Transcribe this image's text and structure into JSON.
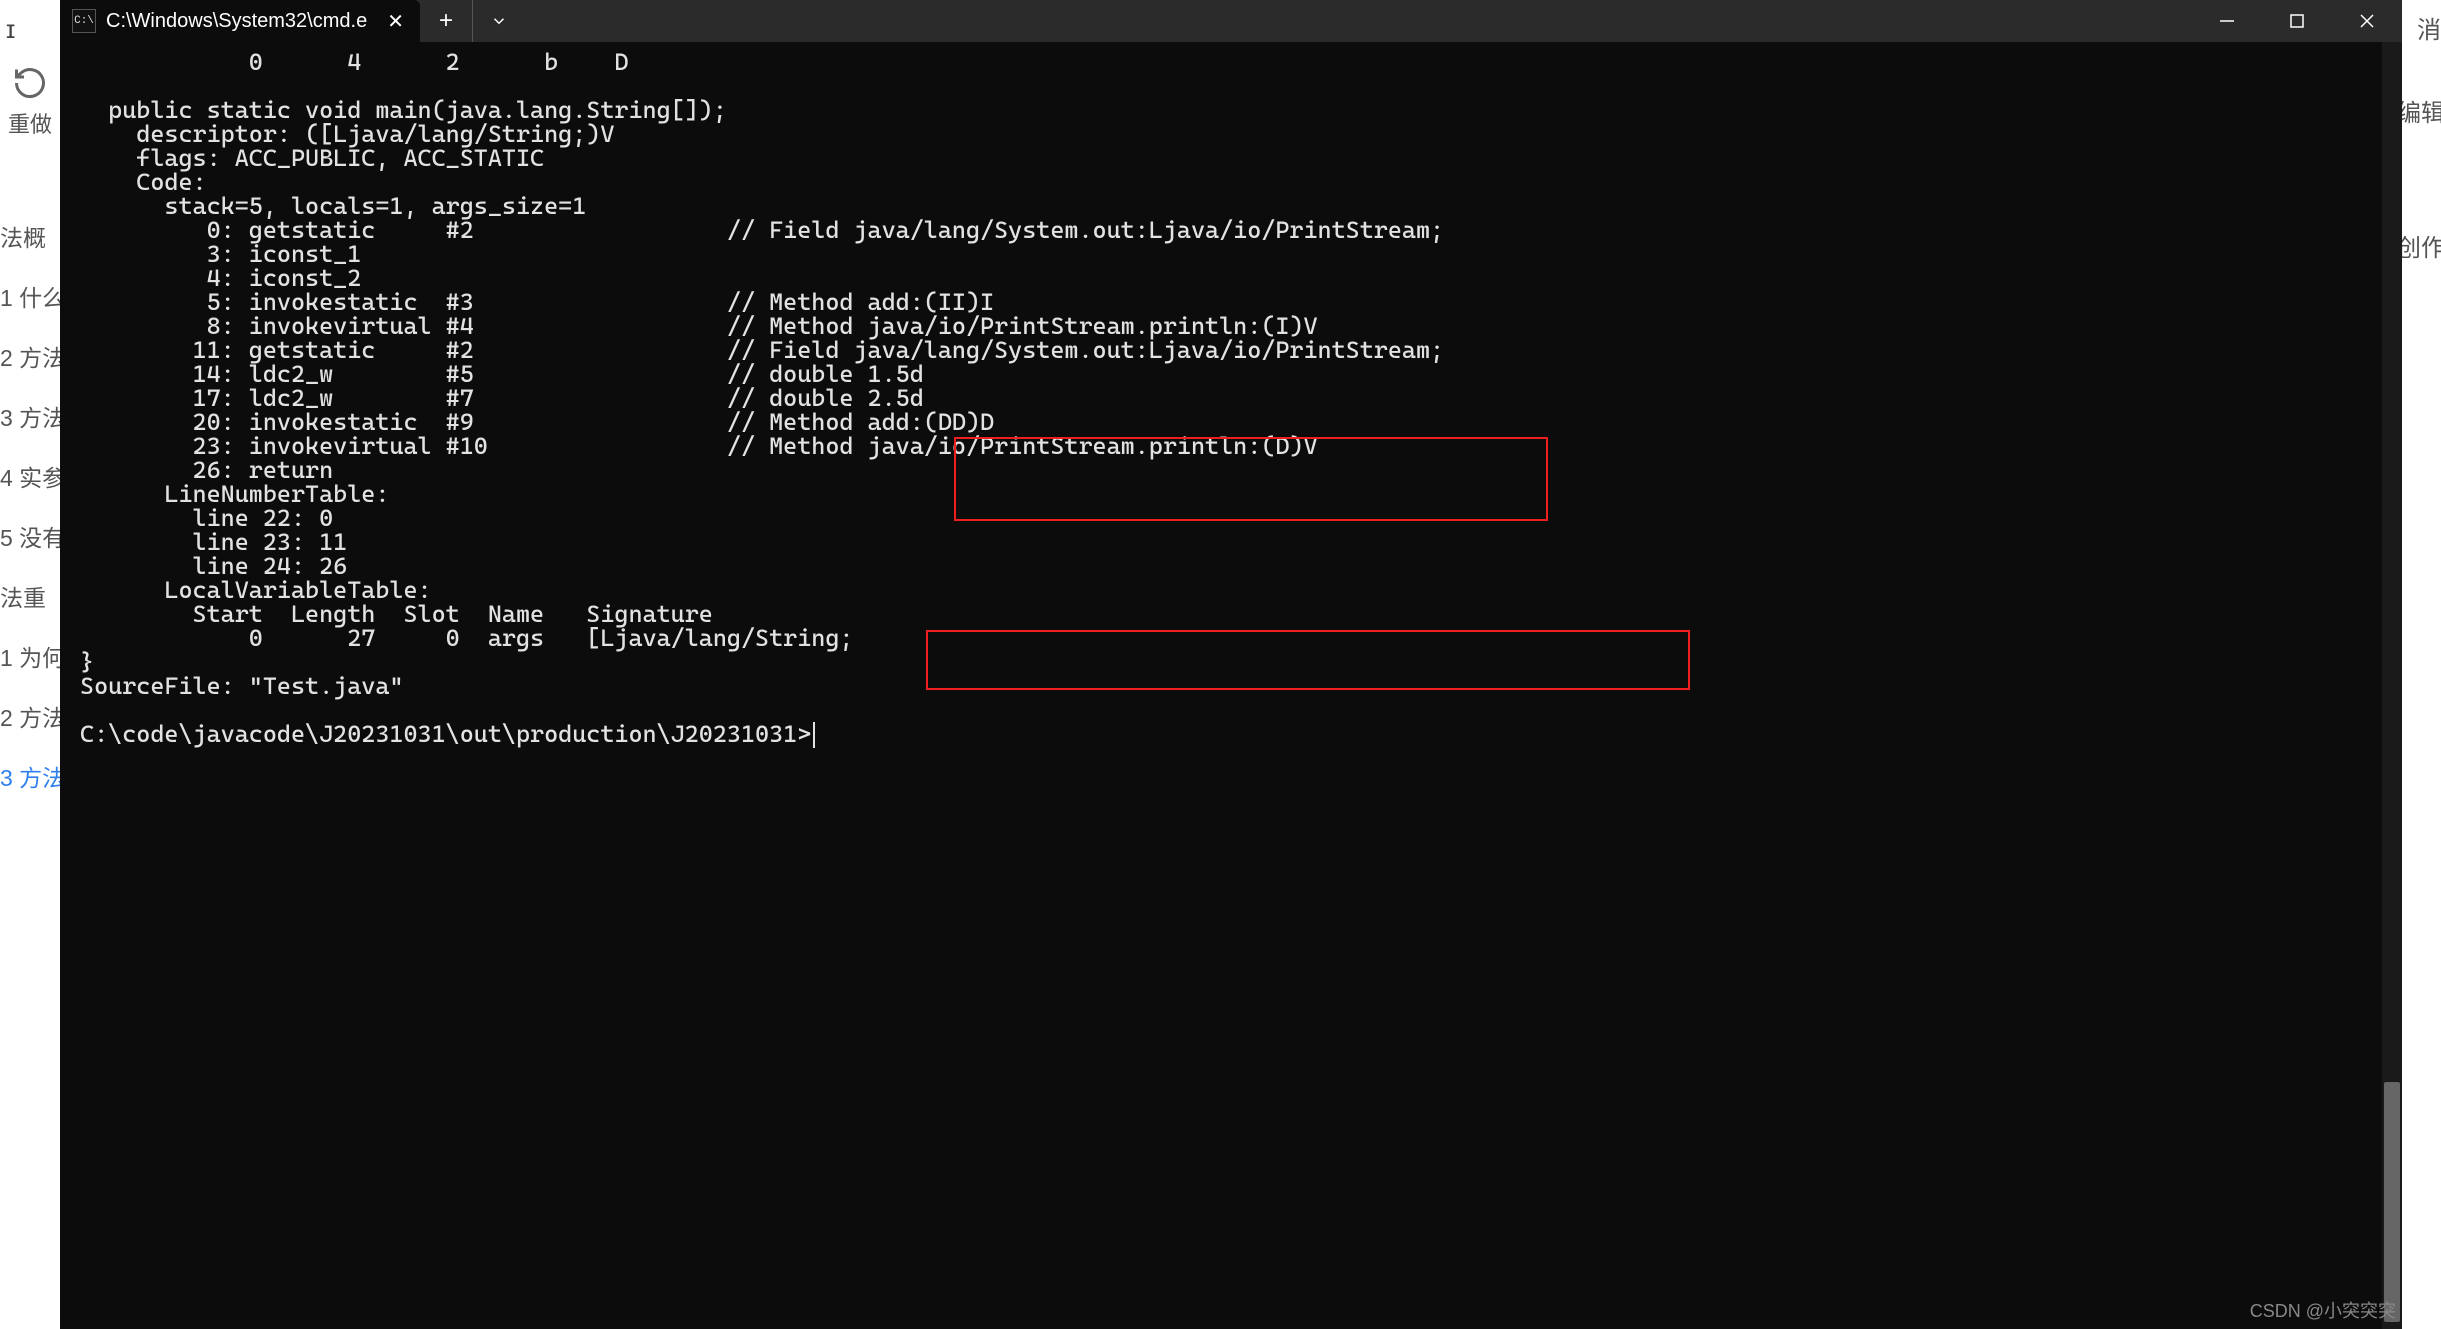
{
  "left_strip": {
    "refresh_label": "重做",
    "top_fragment": "ɪ",
    "items": [
      "法概",
      "1 什么",
      "2 方法",
      "3 方法",
      "4 实参",
      "5 没有",
      "法重",
      "1 为何",
      "2 方法",
      "3 方法"
    ],
    "active_index": 9
  },
  "right_strip": {
    "items_top": [
      "消",
      "编辑"
    ],
    "items_mid": [
      "创作"
    ]
  },
  "window": {
    "tab_title": "C:\\Windows\\System32\\cmd.e",
    "new_tab_tooltip": "+",
    "dropdown_tooltip": "⌄"
  },
  "terminal_lines": [
    "            0      4      2      b    D",
    "",
    "  public static void main(java.lang.String[]);",
    "    descriptor: ([Ljava/lang/String;)V",
    "    flags: ACC_PUBLIC, ACC_STATIC",
    "    Code:",
    "      stack=5, locals=1, args_size=1",
    "         0: getstatic     #2                  // Field java/lang/System.out:Ljava/io/PrintStream;",
    "         3: iconst_1",
    "         4: iconst_2",
    "         5: invokestatic  #3                  // Method add:(II)I",
    "         8: invokevirtual #4                  // Method java/io/PrintStream.println:(I)V",
    "        11: getstatic     #2                  // Field java/lang/System.out:Ljava/io/PrintStream;",
    "        14: ldc2_w        #5                  // double 1.5d",
    "        17: ldc2_w        #7                  // double 2.5d",
    "        20: invokestatic  #9                  // Method add:(DD)D",
    "        23: invokevirtual #10                 // Method java/io/PrintStream.println:(D)V",
    "        26: return",
    "      LineNumberTable:",
    "        line 22: 0",
    "        line 23: 11",
    "        line 24: 26",
    "      LocalVariableTable:",
    "        Start  Length  Slot  Name   Signature",
    "            0      27     0  args   [Ljava/lang/String;",
    "}",
    "SourceFile: \"Test.java\"",
    "",
    "C:\\code\\javacode\\J20231031\\out\\production\\J20231031>"
  ],
  "watermark": "CSDN @小突突突"
}
